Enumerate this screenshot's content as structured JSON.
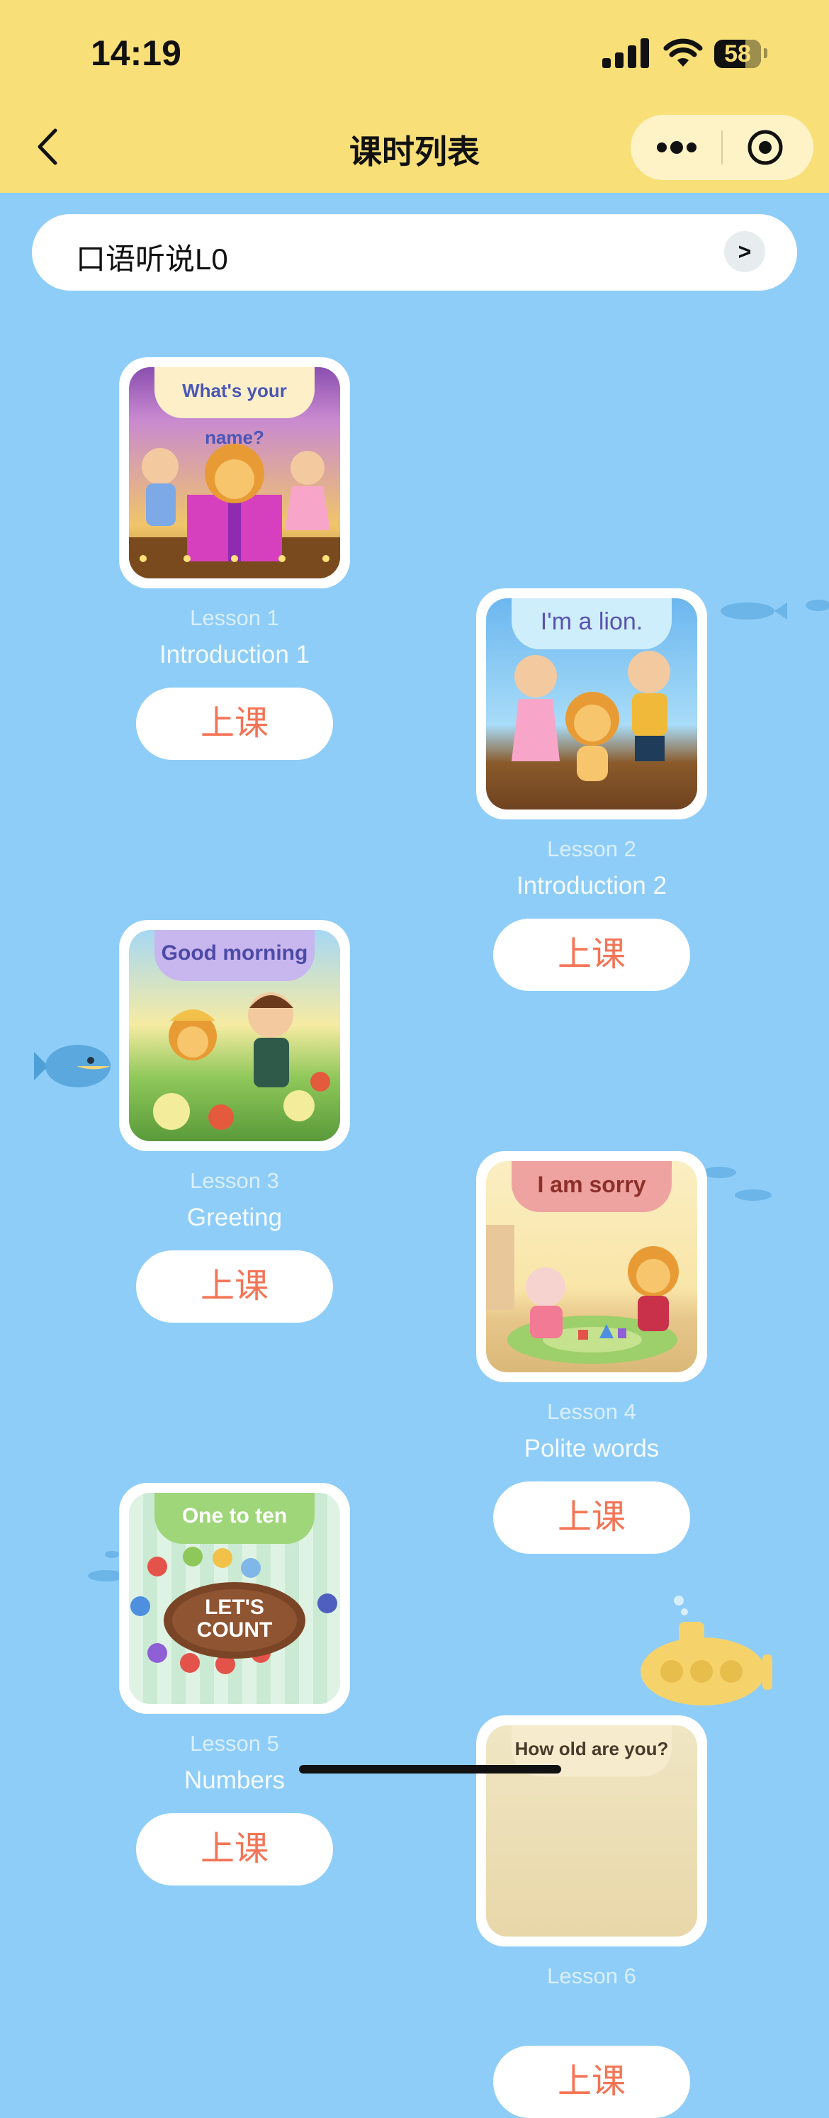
{
  "status_bar": {
    "time": "14:19",
    "battery": "58"
  },
  "nav": {
    "title": "课时列表"
  },
  "course_selector": {
    "name": "口语听说L0",
    "arrow": ">"
  },
  "lessons": [
    {
      "number": "Lesson 1",
      "title": "Introduction 1",
      "button": "上课",
      "banner": "What's your name?"
    },
    {
      "number": "Lesson 2",
      "title": "Introduction 2",
      "button": "上课",
      "banner": "I'm a lion."
    },
    {
      "number": "Lesson 3",
      "title": "Greeting",
      "button": "上课",
      "banner": "Good morning"
    },
    {
      "number": "Lesson 4",
      "title": "Polite words",
      "button": "上课",
      "banner": "I am sorry"
    },
    {
      "number": "Lesson 5",
      "title": "Numbers",
      "button": "上课",
      "banner": "One to ten",
      "art_text": "LET'S COUNT"
    },
    {
      "number": "Lesson 6",
      "title": "",
      "button": "上课",
      "banner": "How old are you?"
    }
  ],
  "colors": {
    "header": "#f8df78",
    "background": "#8ecdf8",
    "button_text": "#f47456"
  }
}
